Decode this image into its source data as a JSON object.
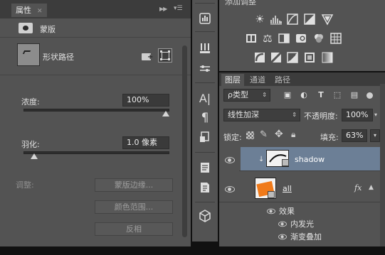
{
  "properties": {
    "tab_label": "属性",
    "mask_type_label": "蒙版",
    "vector_mask_label": "形状路径",
    "density": {
      "label": "浓度:",
      "value": "100%",
      "slider_level": 1.0
    },
    "feather": {
      "label": "羽化:",
      "value": "1.0 像素",
      "slider_level": 0.05
    },
    "refine_label": "调整:",
    "buttons": {
      "mask_edge": "蒙版边缘...",
      "color_range": "颜色范围...",
      "invert": "反相"
    }
  },
  "toolstrip": {
    "icons": [
      "histogram-icon",
      "brush-preset-icon",
      "brush-settings-icon",
      "character-icon",
      "paragraph-icon",
      "clone-source-icon",
      "notes-icon",
      "info-icon",
      "3d-icon"
    ],
    "glyphs": {
      "character": "A|",
      "paragraph": "¶",
      "brush": "✎"
    }
  },
  "adjustments": {
    "title": "添加调整"
  },
  "layers": {
    "tabs": [
      "图层",
      "通道",
      "路径"
    ],
    "filter_kind": "ρ类型",
    "blend_mode": "线性加深",
    "opacity_label": "不透明度:",
    "opacity_value": "100%",
    "lock_label": "锁定:",
    "fill_label": "填充:",
    "fill_value": "63%",
    "items": [
      {
        "name": "shadow",
        "selected": true
      },
      {
        "name": "all",
        "fx": "fx"
      }
    ],
    "effects_label": "效果",
    "effects": [
      "内发光",
      "渐变叠加"
    ],
    "colors": {
      "selected_row": "#6c7f96",
      "layer_thumb": "#f07a1a"
    }
  }
}
